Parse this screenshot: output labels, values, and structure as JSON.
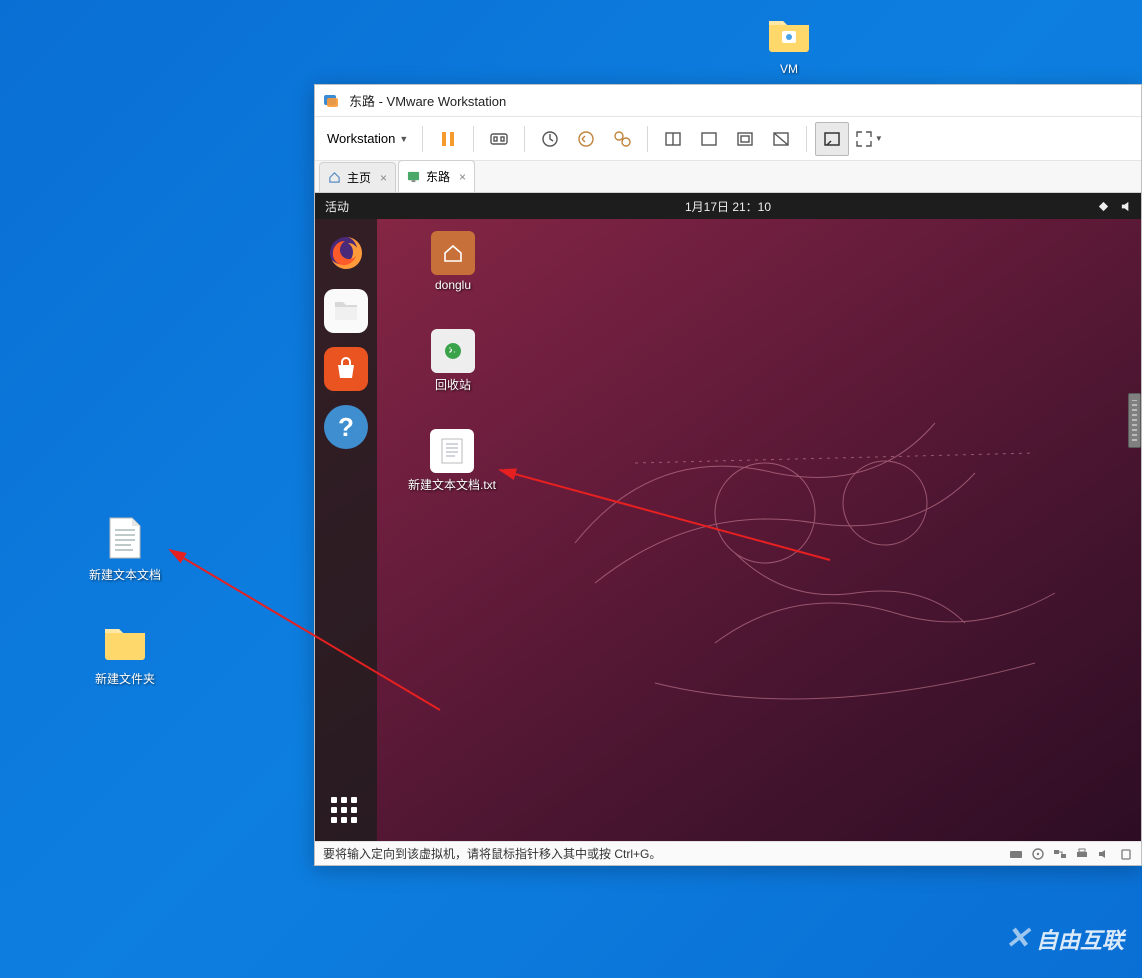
{
  "windows_desktop": {
    "icons": {
      "vm_folder": "VM",
      "text_doc": "新建文本文档",
      "new_folder": "新建文件夹"
    }
  },
  "vmware": {
    "window_title": "东路 - VMware Workstation",
    "menu_label": "Workstation",
    "tabs": {
      "home": "主页",
      "guest": "东路"
    },
    "statusbar_hint": "要将输入定向到该虚拟机，请将鼠标指针移入其中或按 Ctrl+G。"
  },
  "ubuntu": {
    "activities": "活动",
    "clock": "1月17日  21：10",
    "desktop_icons": {
      "home": "donglu",
      "trash": "回收站",
      "textfile": "新建文本文档.txt"
    }
  },
  "watermark": "自由互联"
}
